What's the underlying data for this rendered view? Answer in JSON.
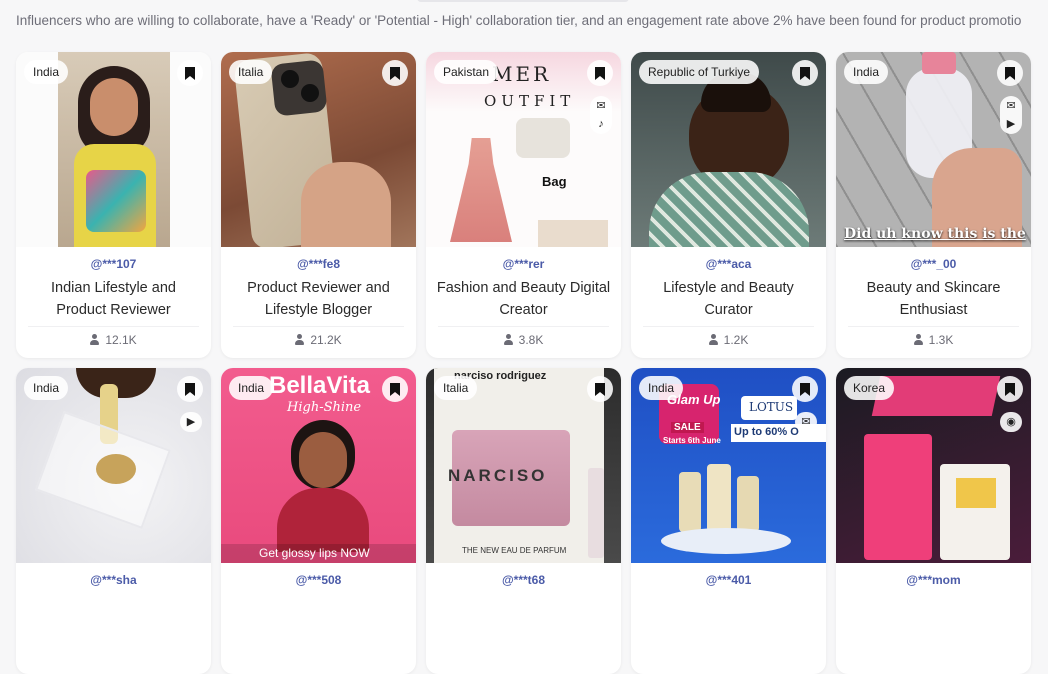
{
  "summary": "Influencers who are willing to collaborate, have a 'Ready' or 'Potential - High' collaboration tier, and an engagement rate above 2% have been found for product promotio",
  "cards": [
    {
      "country": "India",
      "handle": "@***107",
      "title": "Indian Lifestyle and Product Reviewer",
      "followers": "12.1K",
      "icons": []
    },
    {
      "country": "Italia",
      "handle": "@***fe8",
      "title": "Product Reviewer and Lifestyle Blogger",
      "followers": "21.2K",
      "icons": []
    },
    {
      "country": "Pakistan",
      "handle": "@***rer",
      "title": "Fashion and Beauty Digital Creator",
      "followers": "3.8K",
      "icons": [
        "mail-icon",
        "tiktok-icon"
      ],
      "overlay": {
        "t1": "MER",
        "t2": "OUTFIT",
        "t3": "Bag"
      }
    },
    {
      "country": "Republic of Turkiye",
      "handle": "@***aca",
      "title": "Lifestyle and Beauty Curator",
      "followers": "1.2K",
      "icons": []
    },
    {
      "country": "India",
      "handle": "@***_00",
      "title": "Beauty and Skincare Enthusiast",
      "followers": "1.3K",
      "icons": [
        "mail-icon",
        "youtube-icon"
      ],
      "overlay": {
        "t1": "Did uh know this is the"
      }
    },
    {
      "country": "India",
      "handle": "@***sha",
      "icons": [
        "youtube-icon"
      ]
    },
    {
      "country": "India",
      "handle": "@***508",
      "icons": [],
      "overlay": {
        "t1": "BellaVita",
        "t2": "High-Shine",
        "t3": "Get glossy lips NOW"
      }
    },
    {
      "country": "Italia",
      "handle": "@***t68",
      "icons": [],
      "overlay": {
        "t1": "narciso rodriguez",
        "t2": "NARCISO",
        "t3": "THE NEW EAU DE PARFUM"
      }
    },
    {
      "country": "India",
      "handle": "@***401",
      "icons": [
        "mail-icon"
      ],
      "overlay": {
        "t1": "Glam Up",
        "t2": "SALE",
        "t3": "Starts 6th June",
        "t4": "LOTUS",
        "t5": "Up to 60% O"
      }
    },
    {
      "country": "Korea",
      "handle": "@***mom",
      "icons": [
        "sponsored-icon"
      ]
    }
  ],
  "colors": {
    "handle": "#4b5ba8",
    "background": "#f7f7f8"
  }
}
